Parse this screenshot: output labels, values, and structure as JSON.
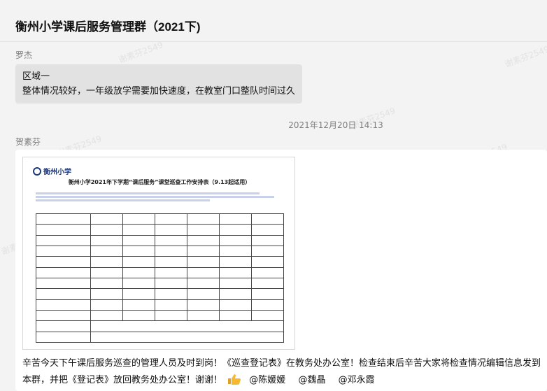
{
  "chat": {
    "title": "衡州小学课后服务管理群（2021下)"
  },
  "messages": [
    {
      "sender": "罗杰",
      "lines": [
        "区域一",
        "整体情况较好，一年级放学需要加快速度，在教室门口整队时间过久"
      ]
    },
    {
      "timestamp": "2021年12月20日 14:13"
    },
    {
      "sender": "贺素芬",
      "attachment": {
        "type": "image",
        "logo_text": "衡州小学",
        "doc_title": "衡州小学2021年下学期“课后服务”课堂巡查工作安排表（9.13起适用）"
      },
      "text": "辛苦今天下午课后服务巡查的管理人员及时到岗！《巡查登记表》在教务处办公室！检查结束后辛苦大家将检查情况编辑信息发到本群，并把《登记表》放回教务处办公室！谢谢！",
      "mentions": [
        "@陈媛媛",
        "@魏晶",
        "@邓永霞"
      ]
    }
  ],
  "watermark": {
    "text": "谢素芬2549"
  },
  "colors": {
    "background": "#f3f3f3",
    "bubble_grey": "#e2e2e2",
    "bubble_white": "#ffffff"
  }
}
